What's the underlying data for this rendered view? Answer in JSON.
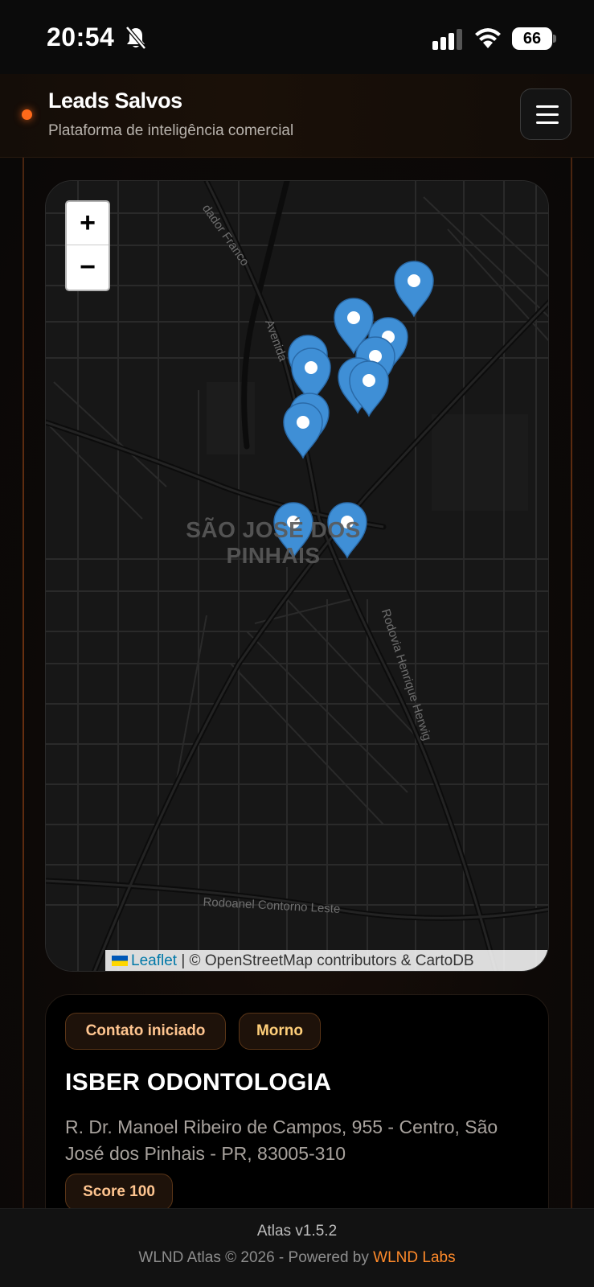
{
  "status_bar": {
    "time": "20:54",
    "battery": "66",
    "icons": [
      "bell-slash-icon",
      "cellular-signal-icon",
      "wifi-icon",
      "battery-icon"
    ]
  },
  "header": {
    "title": "Leads Salvos",
    "subtitle": "Plataforma de inteligência comercial",
    "menu_icon": "hamburger-menu-icon",
    "accent": "#ff6a1a"
  },
  "map": {
    "zoom_in": "+",
    "zoom_out": "−",
    "city_label": "SÃO JOSÉ DOS PINHAIS",
    "road_labels": [
      "Avenida",
      "dador Franco",
      "Rodovia Henrique Herwig",
      "Rodoanel Contorno Leste"
    ],
    "attribution": {
      "leaflet": "Leaflet",
      "separator": " | ",
      "credits": "© OpenStreetMap contributors & CartoDB"
    },
    "marker_color": "#3f8fd6",
    "marker_count": 13
  },
  "lead_card": {
    "status": "Contato iniciado",
    "temperature": "Morno",
    "name": "ISBER ODONTOLOGIA",
    "address": "R. Dr. Manoel Ribeiro de Campos, 955 - Centro, São José dos Pinhais - PR, 83005-310",
    "score": "Score 100"
  },
  "footer": {
    "version": "Atlas v1.5.2",
    "copyright_prefix": "WLND Atlas © 2026 - Powered by ",
    "brand": "WLND Labs",
    "brand_color": "#ff8a2a"
  }
}
